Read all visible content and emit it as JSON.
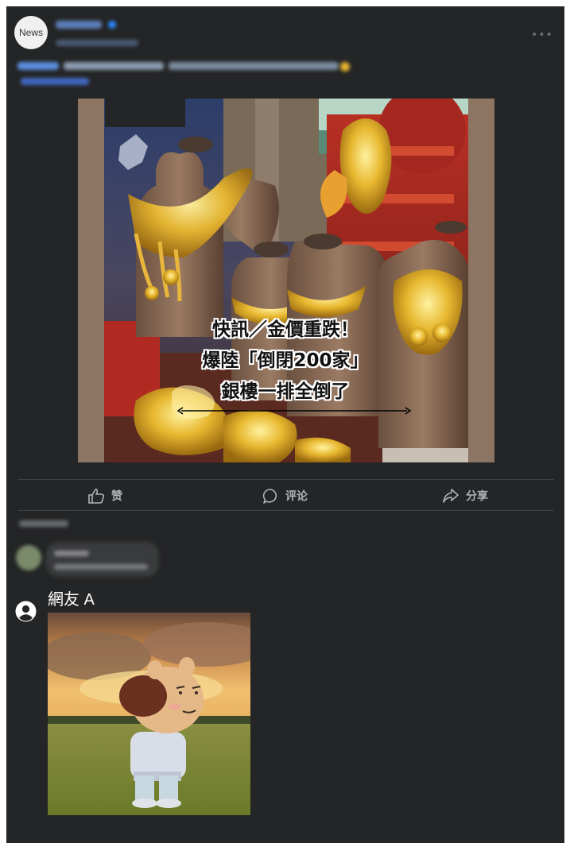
{
  "post": {
    "avatar_label": "News",
    "more_label": "•••"
  },
  "image": {
    "caption_line1": "快訊／金價重跌！",
    "caption_line2": "爆陸「倒閉200家」",
    "caption_line3": "銀樓一排全倒了"
  },
  "actions": {
    "like_label": "赞",
    "comment_label": "评论",
    "share_label": "分享"
  },
  "comment": {
    "author": "網友 A"
  },
  "colors": {
    "panel_bg": "#242526",
    "divider": "#3e4042",
    "action_text": "#b0b3b8",
    "photo_border": "#8c7563"
  }
}
